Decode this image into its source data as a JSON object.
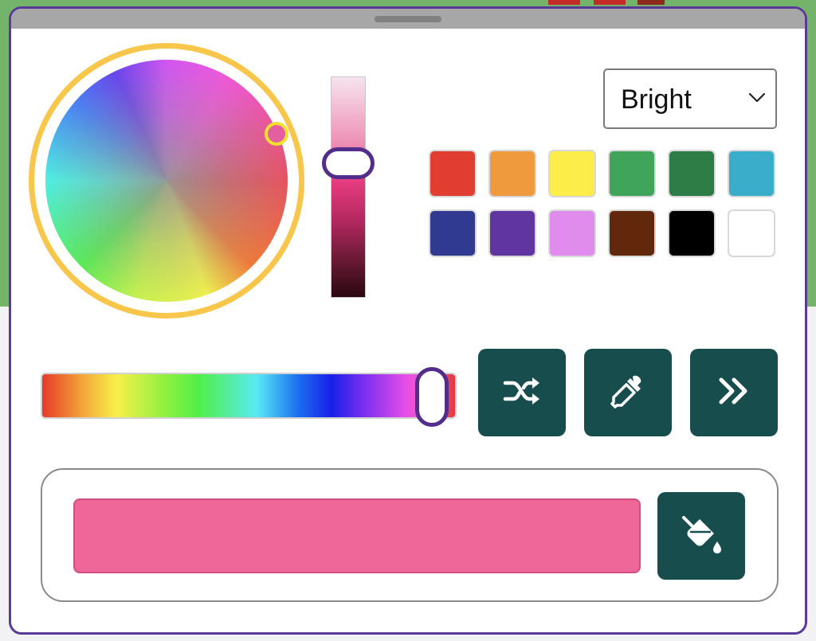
{
  "palette_select": {
    "value": "Bright"
  },
  "swatches": [
    {
      "name": "red",
      "color": "#e13d31"
    },
    {
      "name": "orange",
      "color": "#f09a3e"
    },
    {
      "name": "yellow",
      "color": "#fded4a"
    },
    {
      "name": "green",
      "color": "#40a55a"
    },
    {
      "name": "dark-green",
      "color": "#2f7d46"
    },
    {
      "name": "teal",
      "color": "#3aadca"
    },
    {
      "name": "navy",
      "color": "#313a91"
    },
    {
      "name": "purple",
      "color": "#6135a1"
    },
    {
      "name": "lavender",
      "color": "#e08ced"
    },
    {
      "name": "brown",
      "color": "#62280b"
    },
    {
      "name": "black",
      "color": "#000000"
    },
    {
      "name": "white",
      "color": "#ffffff"
    }
  ],
  "current_color": "#ef6699",
  "icons": {
    "random": "shuffle-icon",
    "picker": "eyedropper-icon",
    "next": "double-chevron-right-icon",
    "fill": "paint-bucket-icon",
    "dropdown": "chevron-down-icon"
  },
  "colors": {
    "panel_border": "#5a3a98",
    "accent_ring": "#f8c64a",
    "button_bg": "#174d4d"
  }
}
